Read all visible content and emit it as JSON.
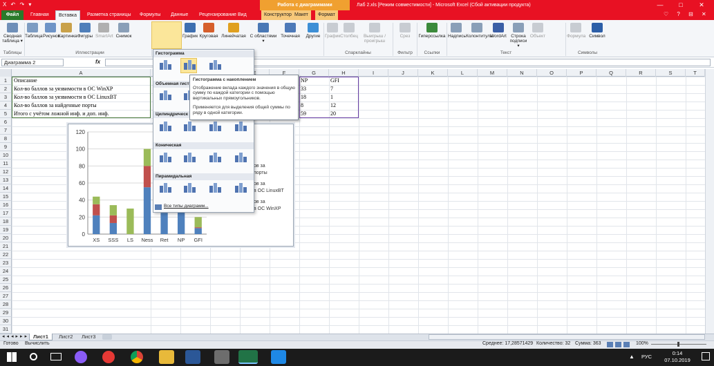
{
  "title_bar": {
    "quick_access": "X ↶ ↷ ▾",
    "context_header": "Работа с диаграммами",
    "window_title": "Лаб 2.xls [Режим совместимости] - Microsoft Excel (Сбой активации продукта)",
    "minimize": "—",
    "maximize": "□",
    "close": "✕"
  },
  "tabs": [
    {
      "label": "Файл"
    },
    {
      "label": "Главная"
    },
    {
      "label": "Вставка"
    },
    {
      "label": "Разметка страницы"
    },
    {
      "label": "Формулы"
    },
    {
      "label": "Данные"
    },
    {
      "label": "Рецензирование"
    },
    {
      "label": "Вид"
    },
    {
      "label": "Конструктор"
    },
    {
      "label": "Макет"
    },
    {
      "label": "Формат"
    }
  ],
  "tab_icons": "♡ ? ⊟ ✕",
  "ribbon": {
    "buttons": [
      {
        "label": "Сводная таблица ▾",
        "color": "#6f8fb8"
      },
      {
        "label": "Таблица",
        "color": "#7d9cc2"
      },
      {
        "label": "Рисунок",
        "color": "#6e94c7"
      },
      {
        "label": "Картинка",
        "color": "#c9a14a"
      },
      {
        "label": "Фигуры",
        "color": "#4f7fba"
      },
      {
        "label": "SmartArt",
        "color": "#b0b0b0"
      },
      {
        "label": "Снимок",
        "color": "#8a9fb8"
      },
      {
        "label": "Гистограмма",
        "color": "#c0392b"
      },
      {
        "label": "График",
        "color": "#3e6fb0"
      },
      {
        "label": "Круговая",
        "color": "#d65f2c"
      },
      {
        "label": "Линейчатая",
        "color": "#e0a020"
      },
      {
        "label": "С областями ▾",
        "color": "#4a78b5"
      },
      {
        "label": "Точечная",
        "color": "#4d79b8"
      },
      {
        "label": "Другие",
        "color": "#3d8fd6"
      },
      {
        "label": "График",
        "color": "#c8ccd2"
      },
      {
        "label": "Столбец",
        "color": "#c8ccd2"
      },
      {
        "label": "Выигрыш / проигрыш",
        "color": "#c8ccd2"
      },
      {
        "label": "Срез",
        "color": "#c8ccd2"
      },
      {
        "label": "Гиперссылка",
        "color": "#3b8a3b"
      },
      {
        "label": "Надпись",
        "color": "#8a9fb8"
      },
      {
        "label": "Колонтитулы",
        "color": "#8a9fb8"
      },
      {
        "label": "WordArt",
        "color": "#3b5fa6"
      },
      {
        "label": "Строка подписи ▾",
        "color": "#8a9fb8"
      },
      {
        "label": "Объект",
        "color": "#c8ccd2"
      },
      {
        "label": "Формула",
        "color": "#c8ccd2"
      },
      {
        "label": "Символ",
        "color": "#2d5fa8"
      }
    ],
    "groups": [
      "Таблицы",
      "Иллюстрации",
      "Спарклайны",
      "Фильтр",
      "Ссылки",
      "Текст",
      "Символы"
    ]
  },
  "formula_bar": {
    "name_box": "Диаграмма 2",
    "fx": "fx",
    "value": ""
  },
  "columns": [
    "A",
    "B",
    "C",
    "D",
    "E",
    "F",
    "G",
    "H",
    "I",
    "J",
    "K",
    "L",
    "M",
    "N",
    "O",
    "P",
    "Q",
    "R",
    "S",
    "T"
  ],
  "rows": [
    "1",
    "2",
    "3",
    "4",
    "5",
    "6",
    "7",
    "8",
    "9",
    "10",
    "11",
    "12",
    "13",
    "14",
    "15",
    "16",
    "17",
    "18",
    "19",
    "20",
    "21",
    "22",
    "23",
    "24",
    "25",
    "26",
    "27",
    "28",
    "29",
    "30",
    "31"
  ],
  "cells": {
    "a1": "Описание",
    "a2": "Кол-во баллов за уязвимости в ОС WinXP",
    "a3": "Кол-во баллов за уязвимости в ОС LinuxBT",
    "a4": "Кол-во баллов за найденные порты",
    "a5": "Итого с учётом ложной инф. и доп. инф.",
    "g1": "NP",
    "g2": "33",
    "g3": "18",
    "g4": "8",
    "g5": "59",
    "h1": "GFI",
    "h2": "7",
    "h3": "1",
    "h4": "12",
    "h5": "20"
  },
  "chart_data": {
    "type": "bar",
    "stacked": true,
    "categories": [
      "XS",
      "SSS",
      "LS",
      "Ness",
      "Ret",
      "NP",
      "GFI"
    ],
    "ylim": [
      0,
      120
    ],
    "yticks": [
      "0",
      "20",
      "40",
      "60",
      "80",
      "100",
      "120"
    ],
    "series": [
      {
        "name": "Кол-во баллов за уязвимости в ОС WinXP",
        "values": [
          22,
          13,
          0,
          55,
          25,
          33,
          7
        ],
        "color": "#4f81bd"
      },
      {
        "name": "Кол-во баллов за уязвимости в ОС LinuxBT",
        "values": [
          13,
          9,
          0,
          25,
          0,
          18,
          1
        ],
        "color": "#c0504d"
      },
      {
        "name": "Кол-во баллов за найденные порты",
        "values": [
          9,
          12,
          30,
          20,
          0,
          8,
          12
        ],
        "color": "#9bbb59"
      }
    ],
    "legend": [
      "ов за",
      "порты",
      "ов за",
      "в ОС LinuxBT",
      "ов за",
      "в ОС WinXP"
    ],
    "legend_position": "right"
  },
  "dropdown": {
    "sections": [
      "Гистограмма",
      "Объемная гист",
      "Цилиндрическ",
      "Коническая",
      "Пирамидальная"
    ],
    "more_link": "Все типы диаграмм..."
  },
  "tooltip": {
    "title": "Гистограмма с накоплением",
    "line1": "Отображение вклада каждого значения в общую сумму по каждой категории с помощью вертикальных прямоугольников.",
    "line2": "Применяется для выделения общей суммы по ряду в одной категории."
  },
  "sheet_tabs": [
    "Лист1",
    "Лист2",
    "Лист3"
  ],
  "status": {
    "ready": "Готово",
    "calc": "Вычислить",
    "average": "Среднее: 17,28571429",
    "count": "Количество: 32",
    "sum": "Сумма: 363",
    "zoom": "100%"
  },
  "taskbar": {
    "lang": "РУС",
    "time": "0:14",
    "date": "07.10.2019"
  }
}
